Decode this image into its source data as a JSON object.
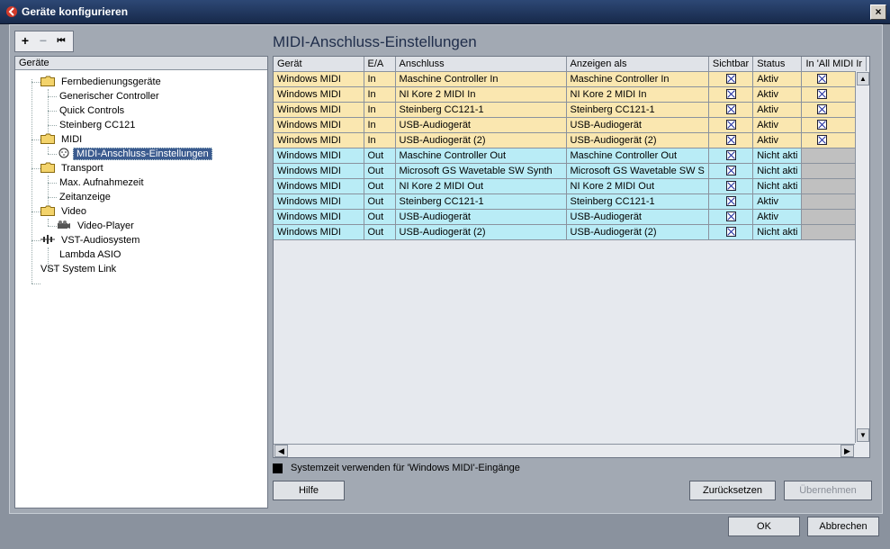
{
  "window": {
    "title": "Geräte konfigurieren",
    "close_label": "×"
  },
  "toolbar": {
    "add": "+",
    "remove": "−",
    "reset": "⏮"
  },
  "tree": {
    "header": "Geräte",
    "items": [
      {
        "label": "Fernbedienungsgeräte"
      },
      {
        "label": "Generischer Controller"
      },
      {
        "label": "Quick Controls"
      },
      {
        "label": "Steinberg CC121"
      },
      {
        "label": "MIDI"
      },
      {
        "label": "MIDI-Anschluss-Einstellungen"
      },
      {
        "label": "Transport"
      },
      {
        "label": "Max. Aufnahmezeit"
      },
      {
        "label": "Zeitanzeige"
      },
      {
        "label": "Video"
      },
      {
        "label": "Video-Player"
      },
      {
        "label": "VST-Audiosystem"
      },
      {
        "label": "Lambda ASIO"
      },
      {
        "label": "VST System Link"
      }
    ]
  },
  "panel": {
    "title": "MIDI-Anschluss-Einstellungen"
  },
  "table": {
    "columns": [
      "Gerät",
      "E/A",
      "Anschluss",
      "Anzeigen als",
      "Sichtbar",
      "Status",
      "In 'All MIDI Ir"
    ],
    "rows": [
      {
        "device": "Windows MIDI",
        "io": "In",
        "port": "Maschine Controller In",
        "show_as": "Maschine Controller In",
        "visible": true,
        "status": "Aktiv",
        "in_all_midi": true
      },
      {
        "device": "Windows MIDI",
        "io": "In",
        "port": "NI Kore 2 MIDI In",
        "show_as": "NI Kore 2 MIDI In",
        "visible": true,
        "status": "Aktiv",
        "in_all_midi": true
      },
      {
        "device": "Windows MIDI",
        "io": "In",
        "port": "Steinberg CC121-1",
        "show_as": "Steinberg CC121-1",
        "visible": true,
        "status": "Aktiv",
        "in_all_midi": true
      },
      {
        "device": "Windows MIDI",
        "io": "In",
        "port": "USB-Audiogerät",
        "show_as": "USB-Audiogerät",
        "visible": true,
        "status": "Aktiv",
        "in_all_midi": true
      },
      {
        "device": "Windows MIDI",
        "io": "In",
        "port": "USB-Audiogerät (2)",
        "show_as": "USB-Audiogerät (2)",
        "visible": true,
        "status": "Aktiv",
        "in_all_midi": true
      },
      {
        "device": "Windows MIDI",
        "io": "Out",
        "port": "Maschine Controller Out",
        "show_as": "Maschine Controller Out",
        "visible": true,
        "status": "Nicht akti",
        "in_all_midi": null
      },
      {
        "device": "Windows MIDI",
        "io": "Out",
        "port": "Microsoft GS Wavetable SW Synth",
        "show_as": "Microsoft GS Wavetable SW S",
        "visible": true,
        "status": "Nicht akti",
        "in_all_midi": null
      },
      {
        "device": "Windows MIDI",
        "io": "Out",
        "port": "NI Kore 2 MIDI Out",
        "show_as": "NI Kore 2 MIDI Out",
        "visible": true,
        "status": "Nicht akti",
        "in_all_midi": null
      },
      {
        "device": "Windows MIDI",
        "io": "Out",
        "port": "Steinberg CC121-1",
        "show_as": "Steinberg CC121-1",
        "visible": true,
        "status": "Aktiv",
        "in_all_midi": null
      },
      {
        "device": "Windows MIDI",
        "io": "Out",
        "port": "USB-Audiogerät",
        "show_as": "USB-Audiogerät",
        "visible": true,
        "status": "Aktiv",
        "in_all_midi": null
      },
      {
        "device": "Windows MIDI",
        "io": "Out",
        "port": "USB-Audiogerät (2)",
        "show_as": "USB-Audiogerät (2)",
        "visible": true,
        "status": "Nicht akti",
        "in_all_midi": null
      }
    ]
  },
  "system_time": {
    "label": "Systemzeit verwenden für 'Windows MIDI'-Eingänge",
    "checked": true
  },
  "buttons": {
    "help": "Hilfe",
    "reset": "Zurücksetzen",
    "apply": "Übernehmen",
    "ok": "OK",
    "cancel": "Abbrechen"
  },
  "colors": {
    "input_row": "#fae7b0",
    "output_row": "#b9ecf6",
    "title_bar": "#2d4875"
  }
}
